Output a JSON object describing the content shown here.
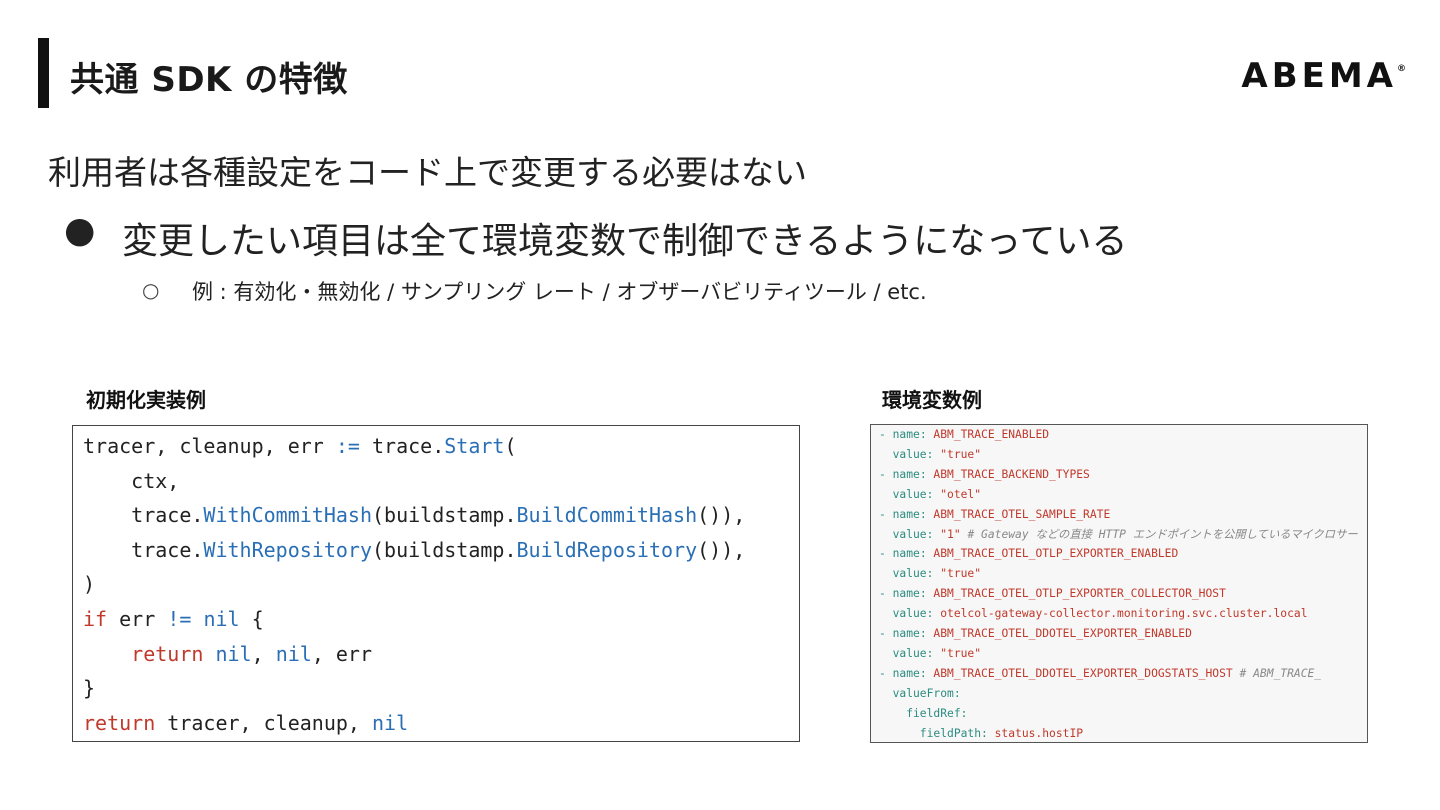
{
  "slide": {
    "title": "共通 SDK の特徴",
    "logo": "ABEMA",
    "logo_mark": "®",
    "line1": "利用者は各種設定をコード上で変更する必要はない",
    "bullet1": "変更したい項目は全て環境変数で制御できるようになっている",
    "bullet1_marker": "●",
    "bullet2": "例 : 有効化・無効化 / サンプリング レート / オブザーバビリティツール / etc.",
    "bullet2_marker": "○",
    "caption_left": "初期化実装例",
    "caption_right": "環境変数例"
  },
  "code": {
    "lines": [
      "tracer, cleanup, err := trace.Start(",
      "    ctx,",
      "    trace.WithCommitHash(buildstamp.BuildCommitHash()),",
      "    trace.WithRepository(buildstamp.BuildRepository()),",
      ")",
      "if err != nil {",
      "    return nil, nil, err",
      "}",
      "return tracer, cleanup, nil"
    ]
  },
  "env": {
    "lines": [
      "- name: ABM_TRACE_ENABLED",
      "  value: \"true\"",
      "- name: ABM_TRACE_BACKEND_TYPES",
      "  value: \"otel\"",
      "- name: ABM_TRACE_OTEL_SAMPLE_RATE",
      "  value: \"1\" # Gateway などの直接 HTTP エンドポイントを公開しているマイクロサー",
      "- name: ABM_TRACE_OTEL_OTLP_EXPORTER_ENABLED",
      "  value: \"true\"",
      "- name: ABM_TRACE_OTEL_OTLP_EXPORTER_COLLECTOR_HOST",
      "  value: otelcol-gateway-collector.monitoring.svc.cluster.local",
      "- name: ABM_TRACE_OTEL_DDOTEL_EXPORTER_ENABLED",
      "  value: \"true\"",
      "- name: ABM_TRACE_OTEL_DDOTEL_EXPORTER_DOGSTATS_HOST # ABM_TRACE_",
      "  valueFrom:",
      "    fieldRef:",
      "      fieldPath: status.hostIP"
    ]
  }
}
